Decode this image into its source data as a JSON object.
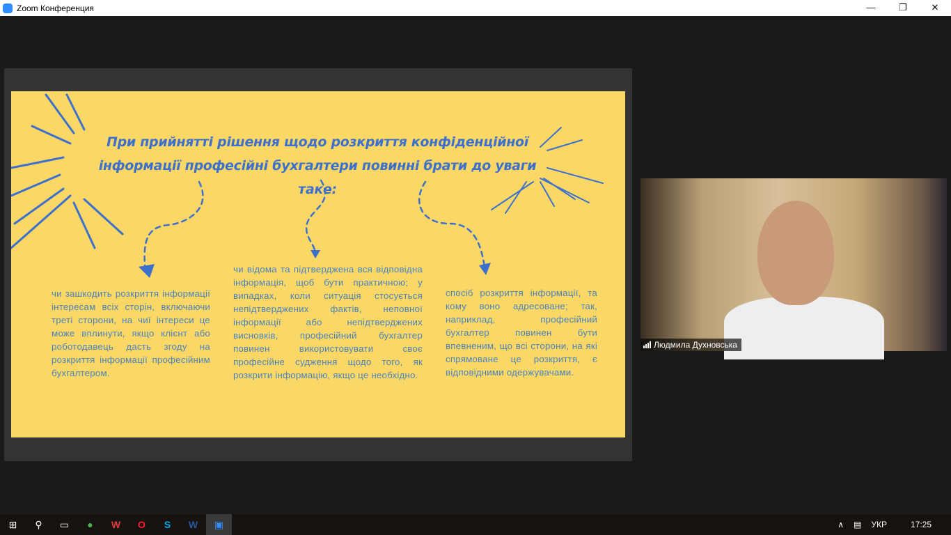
{
  "window": {
    "title": "Zoom Конференция",
    "minimize": "—",
    "restore": "❐",
    "close": "✕"
  },
  "slide": {
    "heading": "При прийнятті рішення щодо розкриття конфіденційної інформації професійні бухгалтери повинні брати до уваги таке:",
    "columns": [
      "чи зашкодить розкриття інформації інтересам всіх сторін, включаючи треті сторони, на чиї інтереси це може вплинути, якщо клієнт або роботодавець дасть згоду на розкриття інформації професійним бухгалтером.",
      "чи відома та підтверджена вся відповідна інформація, щоб бути практичною; у випадках, коли ситуація стосується непідтверджених фактів, неповної інформації або непідтверджених висновків, професійний бухгалтер повинен використовувати своє професійне судження щодо того, як розкрити інформацію, якщо це необхідно.",
      "спосіб розкриття інформації, та кому воно адресоване; так, наприклад, професійний бухгалтер повинен бути впевненим, що всі сторони, на які спрямоване це розкриття, є відповідними одержувачами."
    ],
    "colors": {
      "background": "#fbd865",
      "accent": "#3d6fcc"
    }
  },
  "participant": {
    "name": "Людмила Духновська"
  },
  "taskbar": {
    "apps": [
      "start",
      "search",
      "task-view",
      "chrome",
      "wps",
      "opera",
      "skype",
      "word",
      "zoom"
    ],
    "icons": {
      "start": "⊞",
      "search": "⚲",
      "task-view": "▭",
      "chrome": "●",
      "wps": "W",
      "opera": "O",
      "skype": "S",
      "word": "W",
      "zoom": "▣"
    },
    "chevron": "∧",
    "lang": "УКР",
    "time": "17:25"
  }
}
